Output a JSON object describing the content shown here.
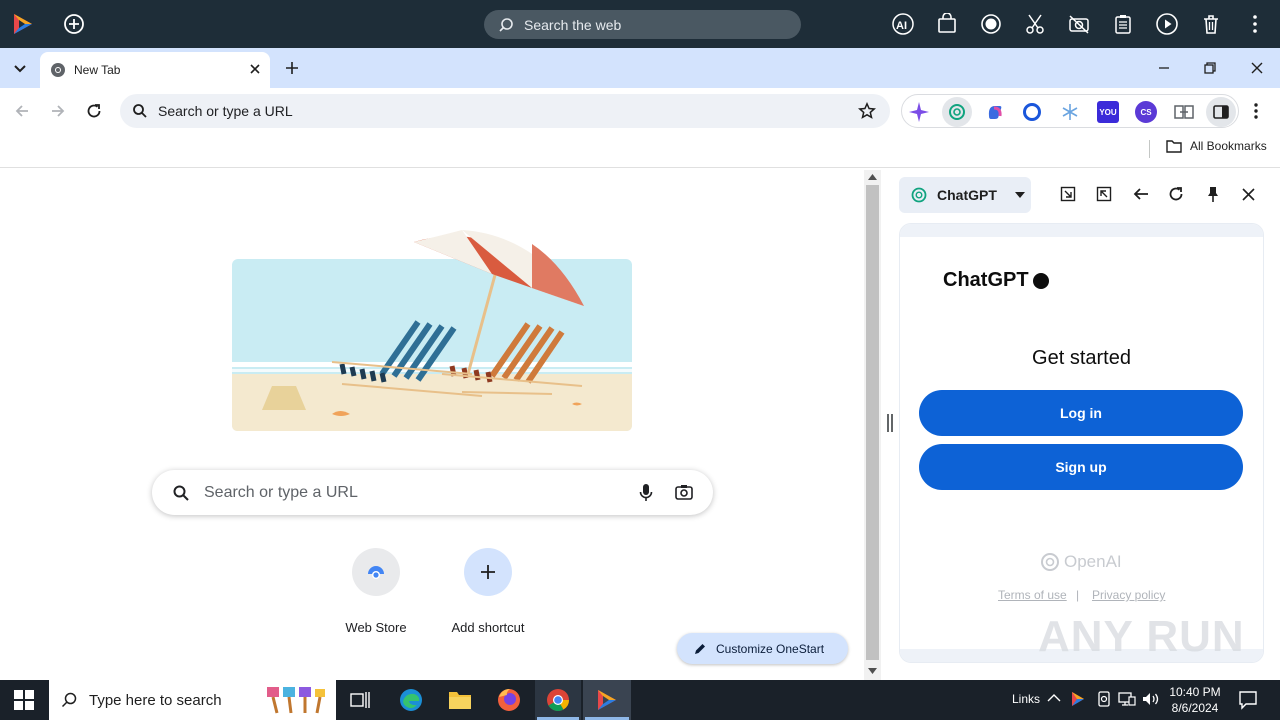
{
  "appbar": {
    "search_placeholder": "Search the web"
  },
  "tab": {
    "title": "New Tab"
  },
  "omnibox": {
    "placeholder": "Search or type a URL"
  },
  "extensions": {
    "you_label": "YOU",
    "cs_label": "CS"
  },
  "bookmarks": {
    "all_bookmarks": "All Bookmarks"
  },
  "newtab": {
    "search_placeholder": "Search or type a URL",
    "shortcuts": [
      {
        "label": "Web Store"
      },
      {
        "label": "Add shortcut"
      }
    ],
    "customize_label": "Customize OneStart"
  },
  "sidepanel": {
    "selector_label": "ChatGPT",
    "brand": "ChatGPT",
    "heading": "Get started",
    "login_label": "Log in",
    "signup_label": "Sign up",
    "openai_label": "OpenAI",
    "terms_label": "Terms of use",
    "separator": "|",
    "privacy_label": "Privacy policy"
  },
  "watermark": "ANY RUN",
  "taskbar": {
    "search_placeholder": "Type here to search",
    "links_label": "Links",
    "time": "10:40 PM",
    "date": "8/6/2024"
  },
  "colors": {
    "accent_blue": "#0d62d6",
    "tabstrip": "#d3e3fd",
    "appbar": "#1e2d38"
  }
}
